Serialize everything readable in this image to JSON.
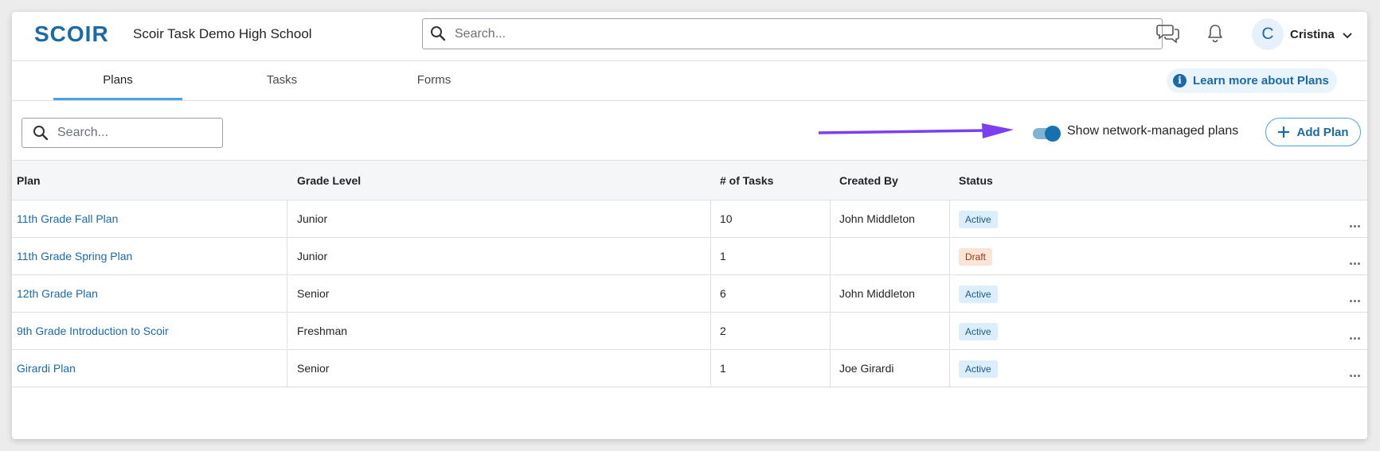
{
  "header": {
    "logo_text": "SCOIR",
    "school_name": "Scoir Task Demo High School",
    "search_placeholder": "Search...",
    "user_initial": "C",
    "user_name": "Cristina"
  },
  "tabs": [
    {
      "label": "Plans",
      "active": true
    },
    {
      "label": "Tasks",
      "active": false
    },
    {
      "label": "Forms",
      "active": false
    }
  ],
  "learn_more_label": "Learn more about Plans",
  "toolbar": {
    "search_placeholder": "Search...",
    "toggle_label": "Show network-managed plans",
    "toggle_on": true,
    "add_plan_label": "Add Plan"
  },
  "table": {
    "columns": [
      "Plan",
      "Grade Level",
      "# of Tasks",
      "Created By",
      "Status"
    ],
    "rows": [
      {
        "plan": "11th Grade Fall Plan",
        "grade": "Junior",
        "tasks": "10",
        "created_by": "John Middleton",
        "status": "Active"
      },
      {
        "plan": "11th Grade Spring Plan",
        "grade": "Junior",
        "tasks": "1",
        "created_by": "",
        "status": "Draft"
      },
      {
        "plan": "12th Grade Plan",
        "grade": "Senior",
        "tasks": "6",
        "created_by": "John Middleton",
        "status": "Active"
      },
      {
        "plan": "9th Grade Introduction to Scoir",
        "grade": "Freshman",
        "tasks": "2",
        "created_by": "",
        "status": "Active"
      },
      {
        "plan": "Girardi Plan",
        "grade": "Senior",
        "tasks": "1",
        "created_by": "Joe Girardi",
        "status": "Active"
      }
    ]
  },
  "colors": {
    "brand": "#1a6aa8",
    "accent": "#4aa3df",
    "arrow": "#7b3ff2",
    "active_badge_bg": "#dcedfb",
    "draft_badge_bg": "#fbe4d6"
  }
}
